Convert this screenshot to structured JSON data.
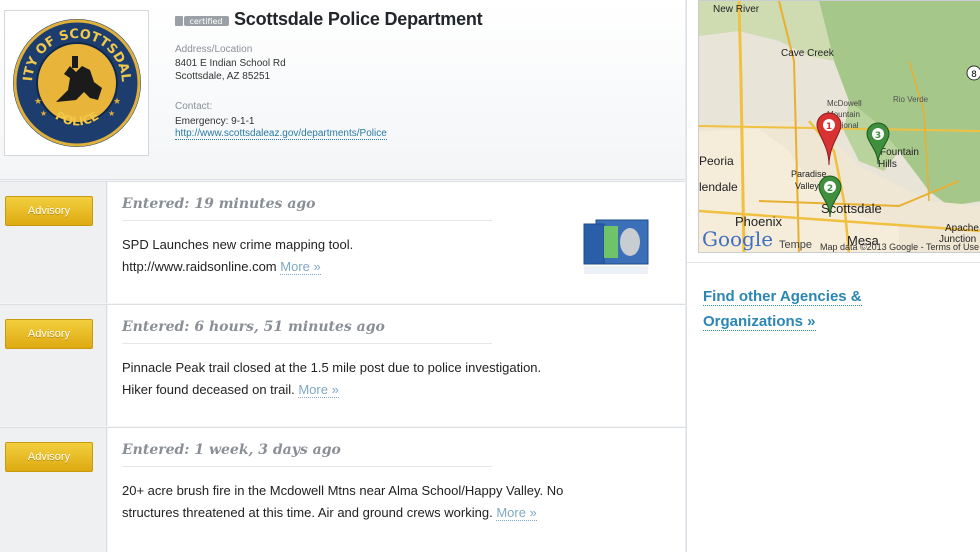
{
  "agency": {
    "certified_label": "certified",
    "name": "Scottsdale Police Department",
    "logo_text_top": "CITY OF SCOTTSDALE",
    "logo_text_bottom": "POLICE",
    "address_label": "Address/Location",
    "address_line1": "8401 E Indian School Rd",
    "address_line2": "Scottsdale, AZ 85251",
    "contact_label": "Contact:",
    "emergency": "Emergency: 9-1-1",
    "website": "http://www.scottsdaleaz.gov/departments/Police"
  },
  "advisories": [
    {
      "badge": "Advisory",
      "entered": "Entered: 19 minutes ago",
      "body": "SPD Launches new crime mapping tool. http://www.raidsonline.com",
      "more": "More »",
      "has_thumbnail": true
    },
    {
      "badge": "Advisory",
      "entered": "Entered: 6 hours, 51 minutes ago",
      "body": "Pinnacle Peak trail closed at the 1.5 mile post due to police investigation. Hiker found deceased on trail.",
      "more": "More »",
      "has_thumbnail": false
    },
    {
      "badge": "Advisory",
      "entered": "Entered: 1 week, 3 days ago",
      "body": "20+ acre brush fire in the Mcdowell Mtns near Alma School/Happy Valley. No structures threatened at this time. Air and ground crews working.",
      "more": "More »",
      "has_thumbnail": false
    }
  ],
  "map": {
    "labels": {
      "new_river": "New River",
      "cave_creek": "Cave Creek",
      "mcdowell": "McDowell",
      "mountain": "Mountain",
      "regional": "Regional",
      "rio_verde": "Rio Verde",
      "fountain": "Fountain",
      "hills": "Hills",
      "peoria": "Peoria",
      "glendale": "lendale",
      "paradise": "Paradise",
      "valley": "Valley",
      "scottsdale": "Scottsdale",
      "phoenix": "Phoenix",
      "mesa": "Mesa",
      "apache": "Apache",
      "junction": "Junction",
      "tempe": "Tempe",
      "highway_shield": "8"
    },
    "google_logo": "Google",
    "attribution": "Map data ©2013 Google - Terms of Use",
    "markers": [
      "1",
      "2",
      "3"
    ],
    "colors": {
      "marker_red": "#d83232",
      "marker_green": "#3f8f3f"
    }
  },
  "find_other": "Find other Agencies & Organizations »",
  "colors": {
    "badge": "#e6b61c",
    "link": "#2b86b3",
    "heading": "#22262b"
  }
}
